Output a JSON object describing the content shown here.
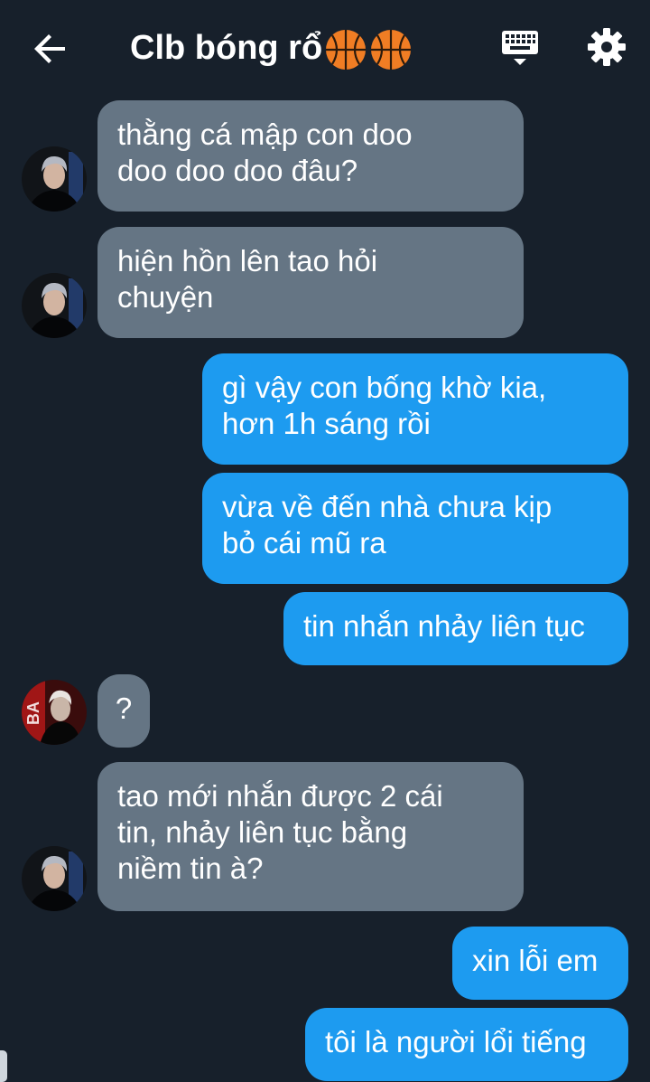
{
  "header": {
    "title": "Clb bóng rổ",
    "back_icon": "arrow-left-icon",
    "keyboard_icon": "keyboard-icon",
    "settings_icon": "gear-icon",
    "title_emojis": [
      "basketball-icon",
      "basketball-icon"
    ]
  },
  "colors": {
    "background": "#17202b",
    "incoming_bubble": "#657584",
    "outgoing_bubble": "#1d9bf0"
  },
  "messages": [
    {
      "direction": "incoming",
      "lines": [
        "thằng cá mập con doo",
        "doo doo doo đâu?"
      ]
    },
    {
      "direction": "incoming",
      "lines": [
        "hiện hồn lên tao hỏi",
        "chuyện"
      ]
    },
    {
      "direction": "outgoing",
      "lines": [
        "gì vậy con bống khờ kia,",
        "hơn 1h sáng rồi"
      ]
    },
    {
      "direction": "outgoing",
      "lines": [
        "vừa về đến nhà chưa kịp",
        "bỏ cái mũ ra"
      ]
    },
    {
      "direction": "outgoing",
      "lines": [
        "tin nhắn nhảy liên tục"
      ]
    },
    {
      "direction": "incoming",
      "lines": [
        "?"
      ]
    },
    {
      "direction": "incoming",
      "lines": [
        "tao mới nhắn được 2 cái",
        "tin, nhảy liên tục bằng",
        "niềm tin à?"
      ]
    },
    {
      "direction": "outgoing",
      "lines": [
        "xin lỗi em"
      ]
    },
    {
      "direction": "outgoing",
      "lines": [
        "tôi là người lổi tiếng"
      ]
    }
  ]
}
